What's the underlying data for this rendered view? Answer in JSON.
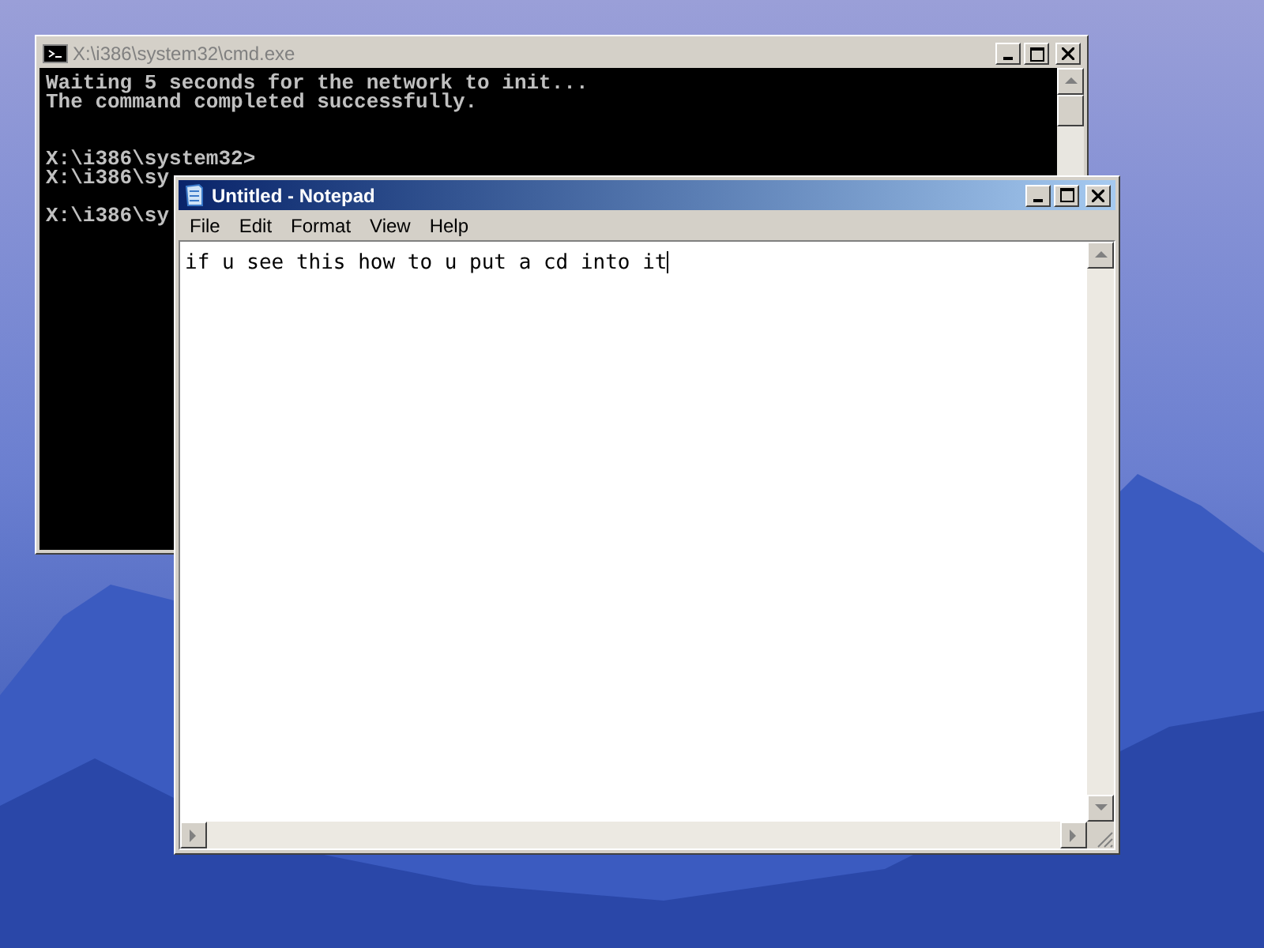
{
  "console_window": {
    "title": "X:\\i386\\system32\\cmd.exe",
    "blocks": [
      {
        "kind": "output",
        "lines": [
          "Waiting 5 seconds for the network to init...",
          "The command completed successfully."
        ]
      },
      {
        "kind": "command",
        "lines": [
          "X:\\i386\\system32>",
          "X:\\i386\\sy"
        ]
      },
      {
        "kind": "command",
        "lines": [
          "X:\\i386\\sy"
        ]
      }
    ]
  },
  "notepad_window": {
    "title": "Untitled - Notepad",
    "menu": [
      "File",
      "Edit",
      "Format",
      "View",
      "Help"
    ],
    "text": "if u see this how to u put a cd into it"
  }
}
